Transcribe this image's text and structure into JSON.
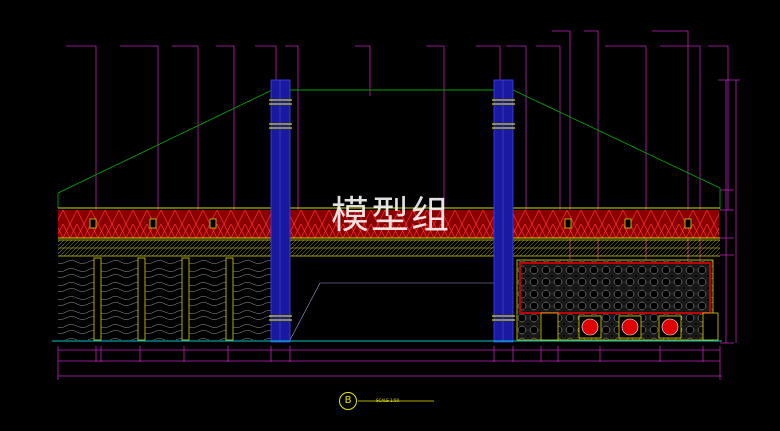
{
  "watermark_text": "模型组",
  "section_tag": "B",
  "scale_text": "SCALE 1:50",
  "colors": {
    "background": "#000000",
    "dimension_magenta": "#c020c0",
    "outline_green": "#00c000",
    "column_blue": "#1a1aa0",
    "detail_yellow": "#d8d800",
    "band_red": "#a00000",
    "cyan_base": "#00c8c8",
    "medallion_red": "#e00000"
  }
}
